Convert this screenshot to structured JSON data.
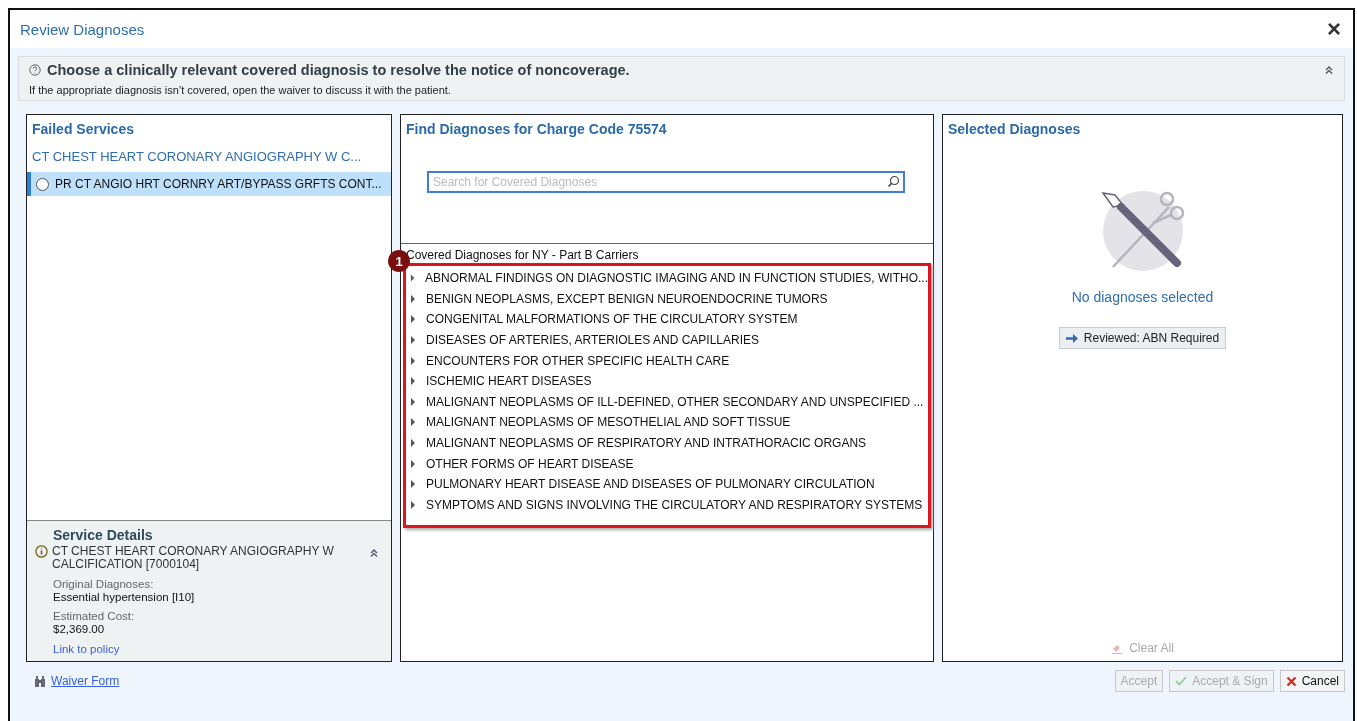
{
  "window": {
    "title": "Review Diagnoses",
    "close": "×"
  },
  "banner": {
    "heading": "Choose a clinically relevant covered diagnosis to resolve the notice of noncoverage.",
    "subtext": "If the appropriate diagnosis isn’t covered, open the waiver to discuss it with the patient.",
    "expanded": true
  },
  "failed_services": {
    "title": "Failed Services",
    "group": "CT CHEST HEART CORONARY ANGIOGRAPHY W C...",
    "items": [
      {
        "label": "PR CT ANGIO HRT CORNRY ART/BYPASS GRFTS CONT...",
        "selected": true
      }
    ]
  },
  "service_details": {
    "title": "Service Details",
    "description": "CT CHEST HEART CORONARY ANGIOGRAPHY W CALCIFICATION [7000104]",
    "expanded": true,
    "fields": [
      {
        "label": "Original Diagnoses:",
        "value": "Essential hypertension [I10]"
      },
      {
        "label": "Estimated Cost:",
        "value": "$2,369.00"
      }
    ],
    "link": "Link to policy"
  },
  "find": {
    "title": "Find Diagnoses for Charge Code 75574",
    "search": {
      "placeholder": "Search for Covered Diagnoses"
    },
    "list_title": "Covered Diagnoses for NY - Part B Carriers",
    "callout": "1",
    "items": [
      {
        "label": "ABNORMAL FINDINGS ON DIAGNOSTIC IMAGING AND IN FUNCTION STUDIES, WITHO...",
        "expanded": false
      },
      {
        "label": "BENIGN NEOPLASMS, EXCEPT BENIGN NEUROENDOCRINE TUMORS",
        "expanded": false
      },
      {
        "label": "CONGENITAL MALFORMATIONS OF THE CIRCULATORY SYSTEM",
        "expanded": false
      },
      {
        "label": "DISEASES OF ARTERIES, ARTERIOLES AND CAPILLARIES",
        "expanded": false
      },
      {
        "label": "ENCOUNTERS FOR OTHER SPECIFIC HEALTH CARE",
        "expanded": false
      },
      {
        "label": "ISCHEMIC HEART DISEASES",
        "expanded": false
      },
      {
        "label": "MALIGNANT NEOPLASMS OF ILL-DEFINED, OTHER SECONDARY AND UNSPECIFIED ...",
        "expanded": false
      },
      {
        "label": "MALIGNANT NEOPLASMS OF MESOTHELIAL AND SOFT TISSUE",
        "expanded": false
      },
      {
        "label": "MALIGNANT NEOPLASMS OF RESPIRATORY AND INTRATHORACIC ORGANS",
        "expanded": false
      },
      {
        "label": "OTHER FORMS OF HEART DISEASE",
        "expanded": false
      },
      {
        "label": "PULMONARY HEART DISEASE AND DISEASES OF PULMONARY CIRCULATION",
        "expanded": false
      },
      {
        "label": "SYMPTOMS AND SIGNS INVOLVING THE CIRCULATORY AND RESPIRATORY SYSTEMS",
        "expanded": false
      }
    ]
  },
  "selected": {
    "title": "Selected Diagnoses",
    "empty": "No diagnoses selected",
    "review_button": "Reviewed: ABN Required",
    "clear": {
      "label": "Clear All",
      "disabled": true
    }
  },
  "footer": {
    "waiver_link": "Waiver Form",
    "buttons": [
      {
        "kind": "plain",
        "label": "Accept",
        "disabled": true
      },
      {
        "kind": "check",
        "label": "Accept & Sign",
        "disabled": true
      },
      {
        "kind": "cancel",
        "label": "Cancel",
        "disabled": false
      }
    ]
  }
}
